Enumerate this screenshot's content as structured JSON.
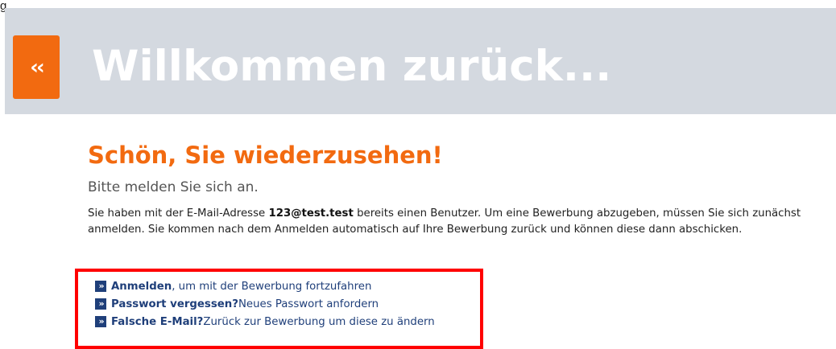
{
  "corner_letter": "g",
  "banner": {
    "back_icon": "double-chevron-left-icon",
    "back_glyph": "‹‹",
    "title": "Willkommen zurück..."
  },
  "content": {
    "headline": "Schön, Sie wiederzusehen!",
    "subline": "Bitte melden Sie sich an.",
    "paragraph_before_email": "Sie haben mit der E-Mail-Adresse ",
    "email": "123@test.test",
    "paragraph_after_email": " bereits einen Benutzer. Um eine Bewerbung abzugeben, müssen Sie sich zunächst anmelden. Sie kommen nach dem Anmelden automatisch auf Ihre Bewerbung zurück und können diese dann abschicken."
  },
  "links": [
    {
      "strong": "Anmelden",
      "rest": ", um mit der Bewerbung fortzufahren"
    },
    {
      "strong": "Passwort vergessen?",
      "rest": " Neues Passwort anfordern"
    },
    {
      "strong": "Falsche E-Mail?",
      "rest": " Zurück zur Bewerbung um diese zu ändern"
    }
  ],
  "colors": {
    "accent_orange": "#f26a10",
    "banner_bg": "#d4d9e0",
    "link_blue": "#1f3f7a",
    "highlight_red": "#ff0000"
  }
}
